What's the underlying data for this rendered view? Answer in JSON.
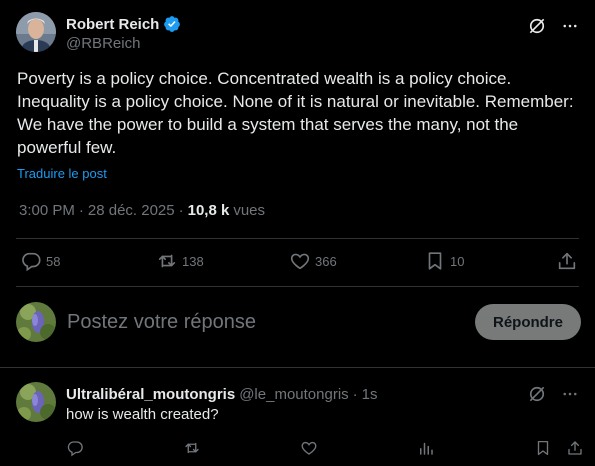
{
  "post": {
    "author_name": "Robert Reich",
    "author_handle": "@RBReich",
    "text": "Poverty is a policy choice. Concentrated wealth is a policy choice. Inequality is a policy choice. None of it is natural or inevitable. Remember: We have the power to build a system that serves the many, not the powerful few.",
    "translate_label": "Traduire le post",
    "time": "3:00 PM",
    "date": "28 déc. 2025",
    "views_count": "10,8 k",
    "views_label": "vues",
    "separator": "·"
  },
  "stats": {
    "replies": "58",
    "reposts": "138",
    "likes": "366",
    "bookmarks": "10"
  },
  "composer": {
    "placeholder": "Postez votre réponse",
    "reply_button": "Répondre"
  },
  "reply": {
    "author_name": "Ultralibéral_moutongris",
    "author_handle": "@le_moutongris",
    "separator": "·",
    "time": "1s",
    "text": "how is wealth created?"
  },
  "colors": {
    "background": "#000000",
    "text": "#e7e9ea",
    "secondary": "#71767b",
    "accent": "#1d9bf0",
    "divider": "#2f3336",
    "verified": "#1d9bf0"
  }
}
